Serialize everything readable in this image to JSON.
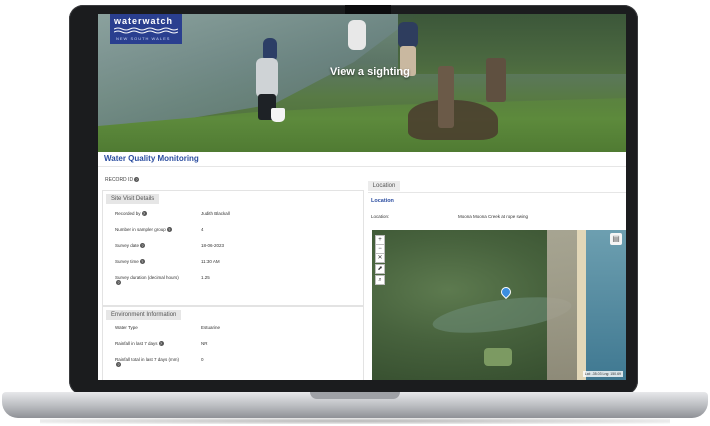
{
  "hero": {
    "logo_title": "waterwatch",
    "logo_subtitle": "NEW SOUTH WALES",
    "title": "View a sighting"
  },
  "page": {
    "title": "Water Quality Monitoring",
    "record_id_label": "RECORD ID"
  },
  "site_visit": {
    "heading": "Site Visit Details",
    "rows": [
      {
        "label": "Recorded by",
        "value": "Judith Blackall"
      },
      {
        "label": "Number in sampler group",
        "value": "4"
      },
      {
        "label": "Survey date",
        "value": "18-06-2023"
      },
      {
        "label": "Survey time",
        "value": "11:30 AM"
      },
      {
        "label": "Survey duration (decimal hours)",
        "value": "1.25"
      }
    ]
  },
  "environment": {
    "heading": "Environment Information",
    "rows": [
      {
        "label": "Water Type",
        "value": "Estuarine"
      },
      {
        "label": "Rainfall in last 7 days",
        "value": "NR"
      },
      {
        "label": "Rainfall total in last 7 days (mm)",
        "value": "0"
      }
    ]
  },
  "location": {
    "tab": "Location",
    "title": "Location",
    "label": "Location:",
    "value": "Moona Moona Creek at rope swing",
    "map_zoom_in": "+",
    "map_zoom_out": "−",
    "map_reset": "✕",
    "map_draw": "⬈",
    "map_search": "⌕",
    "map_layers": "▤",
    "map_coords": "Lat: -35.03 Lng: 150.69"
  }
}
